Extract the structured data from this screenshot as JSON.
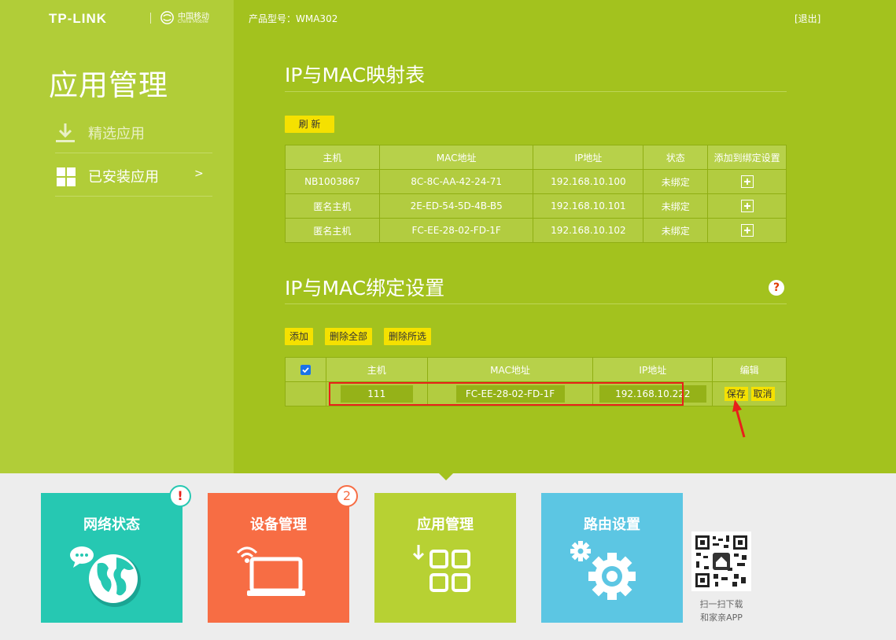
{
  "header": {
    "logo": "TP-LINK",
    "partner_name": "中国移动",
    "partner_sub": "China Mobile",
    "model_label": "产品型号：WMA302",
    "logout": "[退出]"
  },
  "sidebar": {
    "title": "应用管理",
    "items": [
      {
        "label": "精选应用",
        "icon": "download-icon"
      },
      {
        "label": "已安装应用",
        "icon": "grid-icon",
        "arrow": ">"
      }
    ]
  },
  "mapping": {
    "title": "IP与MAC映射表",
    "refresh": "刷 新",
    "columns": [
      "主机",
      "MAC地址",
      "IP地址",
      "状态",
      "添加到绑定设置"
    ],
    "rows": [
      {
        "host": "NB1003867",
        "mac": "8C-8C-AA-42-24-71",
        "ip": "192.168.10.100",
        "status": "未绑定"
      },
      {
        "host": "匿名主机",
        "mac": "2E-ED-54-5D-4B-B5",
        "ip": "192.168.10.101",
        "status": "未绑定"
      },
      {
        "host": "匿名主机",
        "mac": "FC-EE-28-02-FD-1F",
        "ip": "192.168.10.102",
        "status": "未绑定"
      }
    ]
  },
  "binding": {
    "title": "IP与MAC绑定设置",
    "help": "?",
    "buttons": {
      "add": "添加",
      "delete_all": "删除全部",
      "delete_selected": "删除所选"
    },
    "columns": [
      "主机",
      "MAC地址",
      "IP地址",
      "编辑"
    ],
    "edit_row": {
      "host": "111",
      "mac": "FC-EE-28-02-FD-1F",
      "ip": "192.168.10.222",
      "save": "保存",
      "cancel": "取消"
    }
  },
  "tiles": [
    {
      "label": "网络状态",
      "badge": "!",
      "color": "#26c8b2"
    },
    {
      "label": "设备管理",
      "badge": "2",
      "color": "#f76d44"
    },
    {
      "label": "应用管理",
      "color": "#b7d133"
    },
    {
      "label": "路由设置",
      "color": "#5cc6e3"
    }
  ],
  "qr": {
    "caption_line1": "扫一扫下载",
    "caption_line2": "和家亲APP"
  },
  "colors": {
    "main_green": "#a3c21e",
    "sidebar_green": "#b1cd38",
    "button_yellow": "#f5e100",
    "highlight_red": "#e8201a"
  }
}
